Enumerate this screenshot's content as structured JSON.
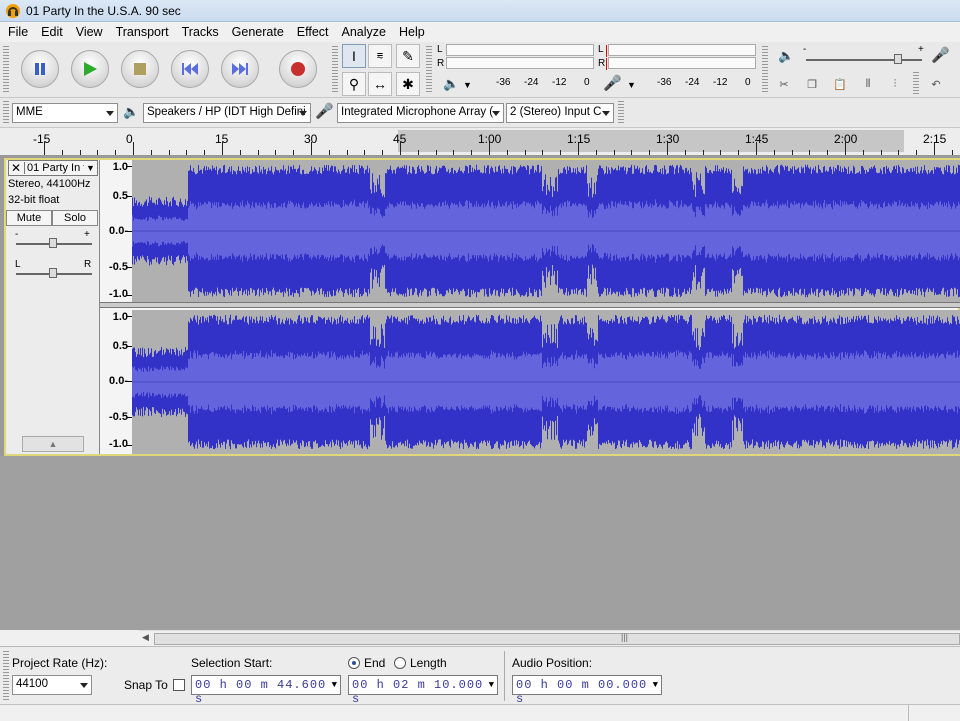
{
  "window": {
    "title": "01 Party In the U.S.A. 90 sec"
  },
  "menu": [
    "File",
    "Edit",
    "View",
    "Transport",
    "Tracks",
    "Generate",
    "Effect",
    "Analyze",
    "Help"
  ],
  "meters": {
    "play": {
      "L": "L",
      "R": "R",
      "scale": [
        "-36",
        "-24",
        "-12",
        "0"
      ]
    },
    "record": {
      "L": "L",
      "R": "R",
      "scale": [
        "-36",
        "-24",
        "-12",
        "0"
      ]
    }
  },
  "devices": {
    "host": "MME",
    "output": "Speakers / HP (IDT High Defini",
    "input": "Integrated Microphone Array (",
    "channels": "2 (Stereo) Input C"
  },
  "ruler": {
    "labels": [
      "-15",
      "0",
      "15",
      "30",
      "45",
      "1:00",
      "1:15",
      "1:30",
      "1:45",
      "2:00",
      "2:15"
    ],
    "selection_start_sec": 44.6,
    "selection_end_sec": 130.0
  },
  "track": {
    "name": "01 Party In t",
    "info1": "Stereo, 44100Hz",
    "info2": "32-bit float",
    "mute": "Mute",
    "solo": "Solo",
    "gain_minus": "-",
    "gain_plus": "+",
    "pan_l": "L",
    "pan_r": "R",
    "scale": [
      "1.0",
      "0.5",
      "0.0-",
      "-0.5",
      "-1.0"
    ]
  },
  "selection_toolbar": {
    "project_rate_label": "Project Rate (Hz):",
    "project_rate": "44100",
    "snap_to": "Snap To",
    "selection_start_label": "Selection Start:",
    "end_label": "End",
    "length_label": "Length",
    "audio_position_label": "Audio Position:",
    "selection_start": "00 h 00 m 44.600 s",
    "selection_end": "00 h 02 m 10.000 s",
    "audio_position": "00 h 00 m 00.000 s"
  },
  "colors": {
    "wave": "#3232c8",
    "wave_rms": "#6464dc",
    "clip_bg": "#b0b0b0"
  }
}
